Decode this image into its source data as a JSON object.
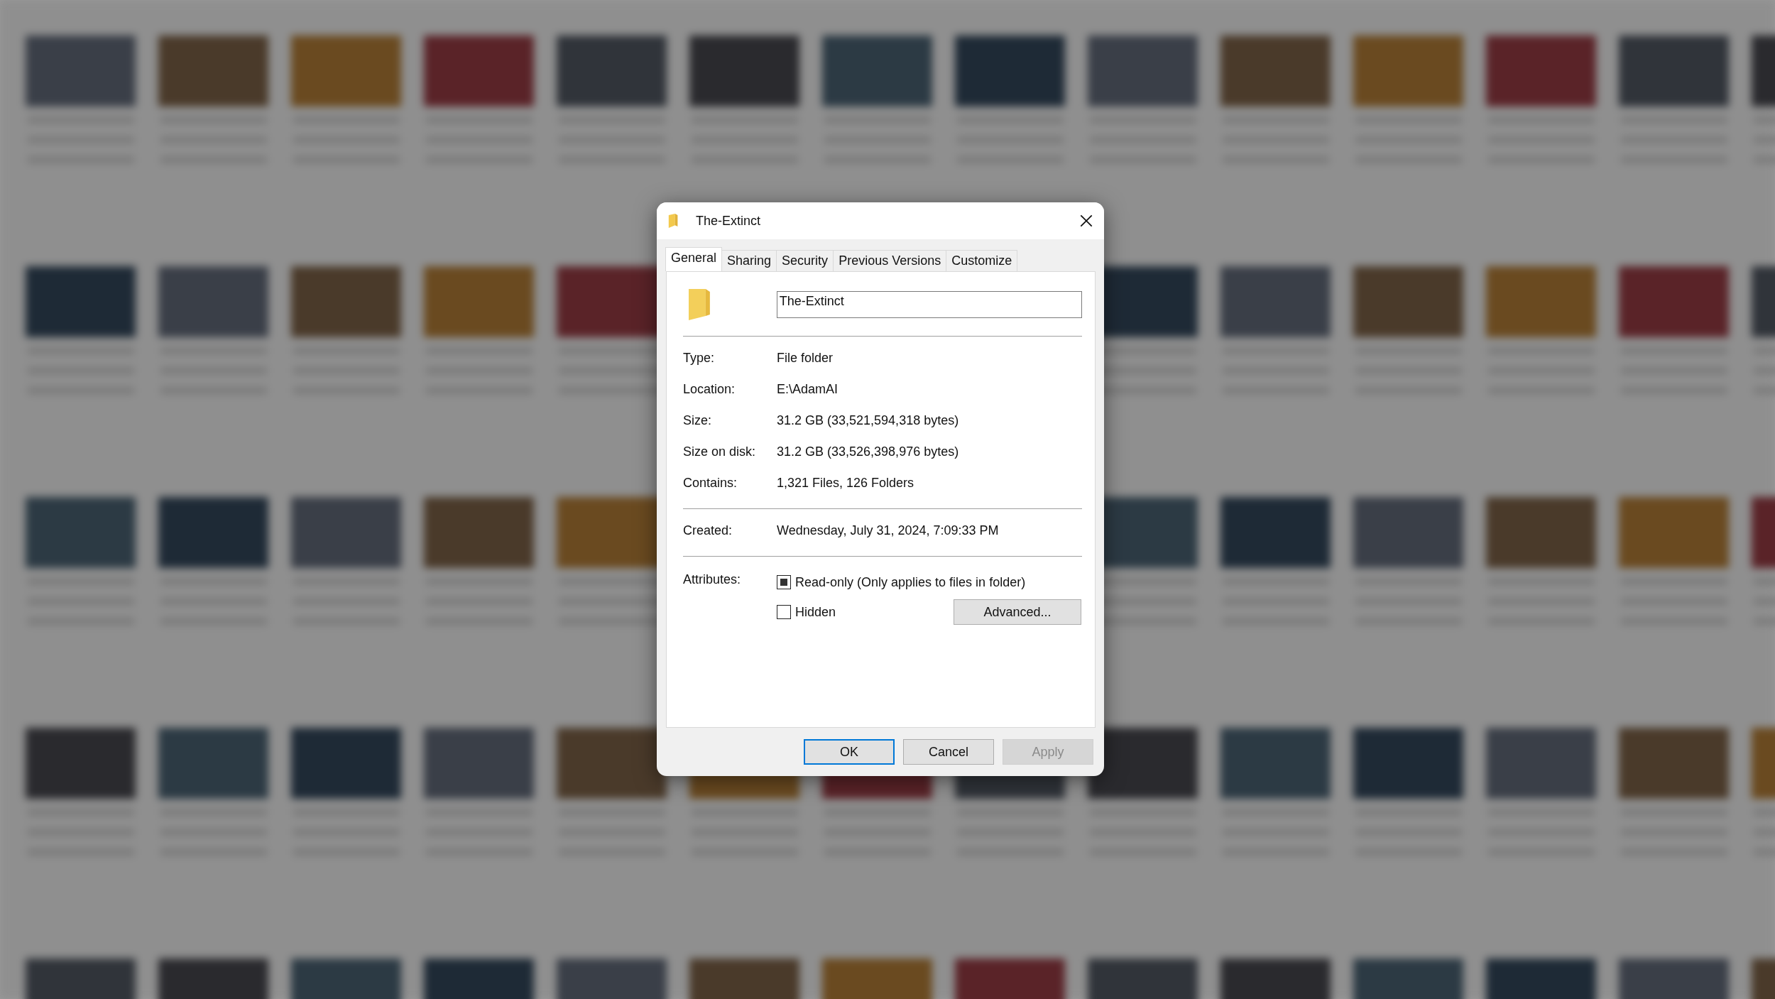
{
  "window": {
    "title": "The-Extinct"
  },
  "tabs": [
    {
      "label": "General",
      "selected": true
    },
    {
      "label": "Sharing",
      "selected": false
    },
    {
      "label": "Security",
      "selected": false
    },
    {
      "label": "Previous Versions",
      "selected": false
    },
    {
      "label": "Customize",
      "selected": false
    }
  ],
  "name_field": {
    "value": "The-Extinct"
  },
  "details": [
    [
      {
        "label": "Type:",
        "value": "File folder"
      },
      {
        "label": "Location:",
        "value": "E:\\AdamAI"
      },
      {
        "label": "Size:",
        "value": "31.2 GB (33,521,594,318 bytes)"
      },
      {
        "label": "Size on disk:",
        "value": "31.2 GB (33,526,398,976 bytes)"
      },
      {
        "label": "Contains:",
        "value": "1,321 Files, 126 Folders"
      }
    ],
    [
      {
        "label": "Created:",
        "value": "Wednesday, July 31, 2024, 7:09:33 PM"
      }
    ]
  ],
  "attributes": {
    "label": "Attributes:",
    "checkboxes": [
      {
        "label": "Read-only (Only applies to files in folder)",
        "checked": false,
        "indeterminate": true
      },
      {
        "label": "Hidden",
        "checked": false,
        "indeterminate": false
      }
    ],
    "advanced_button": "Advanced..."
  },
  "buttons": [
    {
      "label": "OK",
      "default": true,
      "disabled": false
    },
    {
      "label": "Cancel",
      "default": false,
      "disabled": false
    },
    {
      "label": "Apply",
      "default": false,
      "disabled": true
    }
  ]
}
